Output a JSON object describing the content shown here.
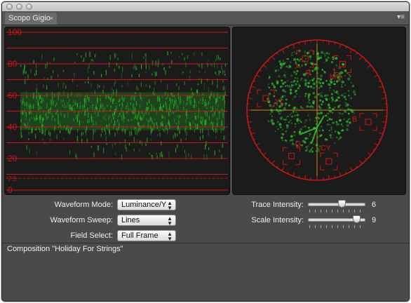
{
  "window": {
    "tab_label": "Scopo Gigio",
    "tab_close_icon": "×",
    "panel_menu_icon": "▾≡"
  },
  "waveform": {
    "scale_labels": [
      "100",
      "80",
      "60",
      "40",
      "20",
      "7.5",
      "0"
    ],
    "scale_values": [
      100,
      80,
      60,
      40,
      20,
      7.5,
      0
    ],
    "ire_lines": [
      100,
      90,
      80,
      70,
      60,
      50,
      40,
      30,
      20,
      10,
      0
    ],
    "trace_band_ire": [
      22,
      88
    ],
    "trace_core_ire": [
      38,
      62
    ]
  },
  "vectorscope": {
    "targets": [
      {
        "label": "R",
        "angle_deg": 103,
        "radius": 0.75
      },
      {
        "label": "MG",
        "angle_deg": 61,
        "radius": 0.75
      },
      {
        "label": "B",
        "angle_deg": 347,
        "radius": 0.75
      },
      {
        "label": "CY",
        "angle_deg": 283,
        "radius": 0.75
      },
      {
        "label": "G",
        "angle_deg": 241,
        "radius": 0.75
      },
      {
        "label": "YL",
        "angle_deg": 167,
        "radius": 0.75
      }
    ]
  },
  "controls": {
    "waveform_mode": {
      "label": "Waveform Mode:",
      "value": "Luminance/Y"
    },
    "waveform_sweep": {
      "label": "Waveform Sweep:",
      "value": "Lines"
    },
    "field_select": {
      "label": "Field Select:",
      "value": "Full Frame"
    },
    "trace_intensity": {
      "label": "Trace Intensity:",
      "value": "6",
      "fraction": 0.6
    },
    "scale_intensity": {
      "label": "Scale Intensity:",
      "value": "9",
      "fraction": 0.9
    }
  },
  "status": {
    "composition": "Composition \"Holiday For Strings\""
  },
  "colors": {
    "scale_red": "#d01515",
    "trace_green": "#2bd42b",
    "vector_axis": "#d08a10"
  }
}
